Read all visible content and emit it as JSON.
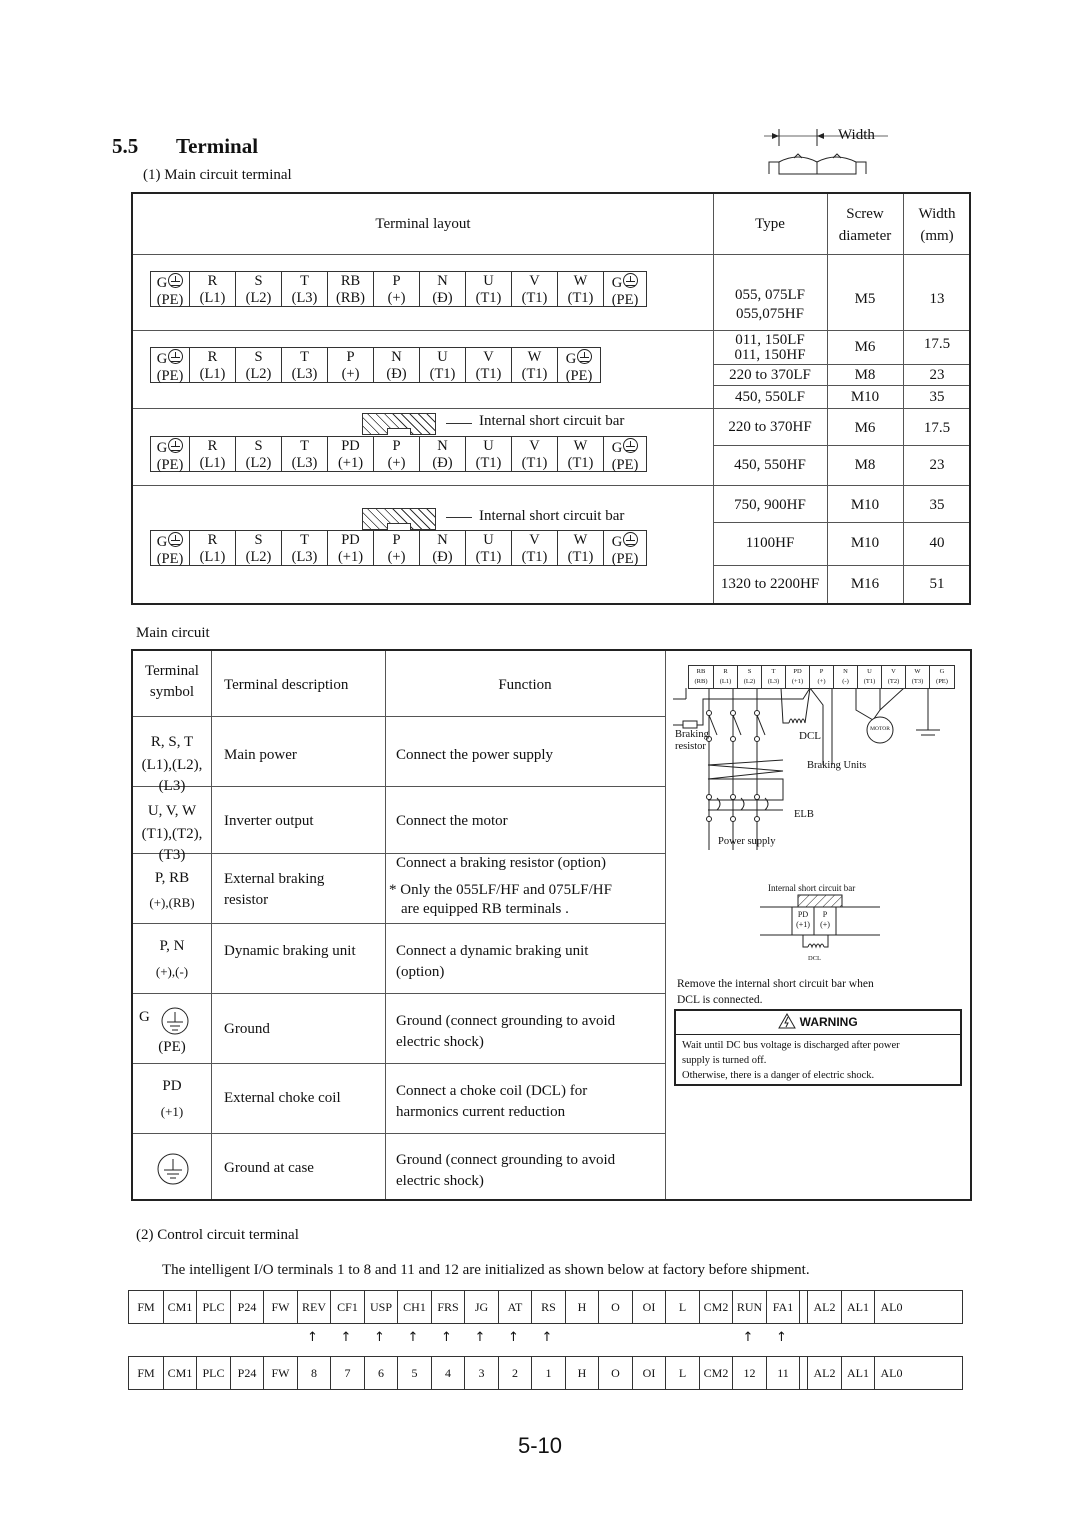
{
  "section": {
    "number": "5.5",
    "title": "Terminal"
  },
  "main_circuit_terminal_heading": "(1) Main circuit terminal",
  "width_diagram_label": "Width",
  "terminal_table": {
    "headers": {
      "layout": "Terminal layout",
      "type": "Type",
      "screw": "Screw diameter",
      "screw_line1": "Screw",
      "screw_line2": "diameter",
      "width_line1": "Width",
      "width_line2": "(mm)"
    },
    "layouts": [
      {
        "terminals": [
          [
            "G",
            "(PE)"
          ],
          [
            "R",
            "(L1)"
          ],
          [
            "S",
            "(L2)"
          ],
          [
            "T",
            "(L3)"
          ],
          [
            "RB",
            "(RB)"
          ],
          [
            "P",
            "(+)"
          ],
          [
            "N",
            "(Đ)"
          ],
          [
            "U",
            "(T1)"
          ],
          [
            "V",
            "(T1)"
          ],
          [
            "W",
            "(T1)"
          ],
          [
            "G",
            "(PE)"
          ]
        ]
      },
      {
        "terminals": [
          [
            "G",
            "(PE)"
          ],
          [
            "R",
            "(L1)"
          ],
          [
            "S",
            "(L2)"
          ],
          [
            "T",
            "(L3)"
          ],
          [
            "P",
            "(+)"
          ],
          [
            "N",
            "(Đ)"
          ],
          [
            "U",
            "(T1)"
          ],
          [
            "V",
            "(T1)"
          ],
          [
            "W",
            "(T1)"
          ],
          [
            "G",
            "(PE)"
          ]
        ]
      },
      {
        "short_bar_label": "Internal short circuit bar",
        "terminals": [
          [
            "G",
            "(PE)"
          ],
          [
            "R",
            "(L1)"
          ],
          [
            "S",
            "(L2)"
          ],
          [
            "T",
            "(L3)"
          ],
          [
            "PD",
            "(+1)"
          ],
          [
            "P",
            "(+)"
          ],
          [
            "N",
            "(Đ)"
          ],
          [
            "U",
            "(T1)"
          ],
          [
            "V",
            "(T1)"
          ],
          [
            "W",
            "(T1)"
          ],
          [
            "G",
            "(PE)"
          ]
        ]
      },
      {
        "short_bar_label": "Internal short circuit bar",
        "terminals": [
          [
            "G",
            "(PE)"
          ],
          [
            "R",
            "(L1)"
          ],
          [
            "S",
            "(L2)"
          ],
          [
            "T",
            "(L3)"
          ],
          [
            "PD",
            "(+1)"
          ],
          [
            "P",
            "(+)"
          ],
          [
            "N",
            "(Đ)"
          ],
          [
            "U",
            "(T1)"
          ],
          [
            "V",
            "(T1)"
          ],
          [
            "W",
            "(T1)"
          ],
          [
            "G",
            "(PE)"
          ]
        ]
      }
    ],
    "rows": [
      {
        "type_line1": "055, 075LF",
        "type_line2": "055,075HF",
        "screw": "M5",
        "width": "13"
      },
      {
        "type_line1": "011, 150LF",
        "type_line2": "011, 150HF",
        "screw": "M6",
        "width": "17.5"
      },
      {
        "type_line1": "220 to 370LF",
        "screw": "M8",
        "width": "23"
      },
      {
        "type_line1": "450, 550LF",
        "screw": "M10",
        "width": "35"
      },
      {
        "type_line1": "220 to 370HF",
        "screw": "M6",
        "width": "17.5"
      },
      {
        "type_line1": "450, 550HF",
        "screw": "M8",
        "width": "23"
      },
      {
        "type_line1": "750, 900HF",
        "screw": "M10",
        "width": "35"
      },
      {
        "type_line1": "1100HF",
        "screw": "M10",
        "width": "40"
      },
      {
        "type_line1": "1320 to 2200HF",
        "screw": "M16",
        "width": "51"
      }
    ]
  },
  "main_circuit_label": "Main circuit",
  "function_table": {
    "headers": {
      "symbol_line1": "Terminal",
      "symbol_line2": "symbol",
      "description": "Terminal description",
      "function": "Function"
    },
    "rows": [
      {
        "symbol": "R, S, T",
        "symbol_sub": "(L1),(L2),(L3)",
        "description": "Main power",
        "function": [
          "Connect the power supply"
        ]
      },
      {
        "symbol": "U, V, W",
        "symbol_sub": "(T1),(T2),(T3)",
        "description": "Inverter output",
        "function": [
          "Connect the motor"
        ]
      },
      {
        "symbol": "P, RB",
        "symbol_sub": "(+),(RB)",
        "description": [
          "External braking",
          "resistor"
        ],
        "function": [
          "Connect a braking resistor (option)",
          "* Only the 055LF/HF and 075LF/HF",
          "are equipped RB terminals ."
        ]
      },
      {
        "symbol": "P, N",
        "symbol_sub": "(+),(-)",
        "description": "Dynamic braking unit",
        "function": [
          "Connect a dynamic braking unit",
          "(option)"
        ]
      },
      {
        "symbol": "G",
        "symbol_sub": "(PE)",
        "description": "Ground",
        "function": [
          "Ground (connect grounding to avoid",
          "electric shock)"
        ]
      },
      {
        "symbol": "PD",
        "symbol_sub": "(+1)",
        "description": "External choke coil",
        "function": [
          "Connect a choke coil (DCL) for",
          "harmonics current reduction"
        ]
      },
      {
        "symbol": "",
        "description": "Ground at case",
        "function": [
          "Ground (connect grounding to avoid",
          "electric shock)"
        ]
      }
    ]
  },
  "wiring_diagram": {
    "terminals": [
      [
        "RB",
        "(RB)"
      ],
      [
        "R",
        "(L1)"
      ],
      [
        "S",
        "(L2)"
      ],
      [
        "T",
        "(L3)"
      ],
      [
        "PD",
        "(+1)"
      ],
      [
        "P",
        "(+)"
      ],
      [
        "N",
        "(-)"
      ],
      [
        "U",
        "(T1)"
      ],
      [
        "V",
        "(T2)"
      ],
      [
        "W",
        "(T3)"
      ],
      [
        "G",
        "(PE)"
      ]
    ],
    "labels": {
      "braking_resistor_1": "Braking",
      "braking_resistor_2": "resistor",
      "dcl": "DCL",
      "braking_units": "Braking Units",
      "elb": "ELB",
      "power_supply": "Power supply",
      "motor": "MOTOR"
    }
  },
  "short_bar_diagram": {
    "label": "Internal short circuit bar",
    "terminals": [
      [
        "PD",
        "(+1)"
      ],
      [
        "P",
        "(+)"
      ]
    ],
    "dcl": "DCL",
    "note_line1": "Remove the internal short circuit bar when",
    "note_line2": "DCL is connected."
  },
  "warning": {
    "title": "WARNING",
    "line1": "Wait until DC bus voltage is discharged after power",
    "line2": "supply is turned off.",
    "line3": "Otherwise, there is a danger of electric shock."
  },
  "control_circuit": {
    "heading": "(2) Control circuit terminal",
    "intro": "The intelligent I/O terminals 1 to 8 and 11 and 12 are initialized as shown below at factory before shipment.",
    "top_row": [
      "FM",
      "CM1",
      "PLC",
      "P24",
      "FW",
      "REV",
      "CF1",
      "USP",
      "CH1",
      "FRS",
      "JG",
      "AT",
      "RS",
      "H",
      "O",
      "OI",
      "L",
      "CM2",
      "RUN",
      "FA1",
      "",
      "AL2",
      "AL1",
      "AL0"
    ],
    "bottom_row": [
      "FM",
      "CM1",
      "PLC",
      "P24",
      "FW",
      "8",
      "7",
      "6",
      "5",
      "4",
      "3",
      "2",
      "1",
      "H",
      "O",
      "OI",
      "L",
      "CM2",
      "12",
      "11",
      "",
      "AL2",
      "AL1",
      "AL0"
    ],
    "arrow_flags": [
      0,
      0,
      0,
      0,
      0,
      1,
      1,
      1,
      1,
      1,
      1,
      1,
      1,
      0,
      0,
      0,
      0,
      0,
      1,
      1,
      0,
      0,
      0,
      0
    ],
    "arrow_glyph": "↑"
  },
  "page_number": "5-10"
}
